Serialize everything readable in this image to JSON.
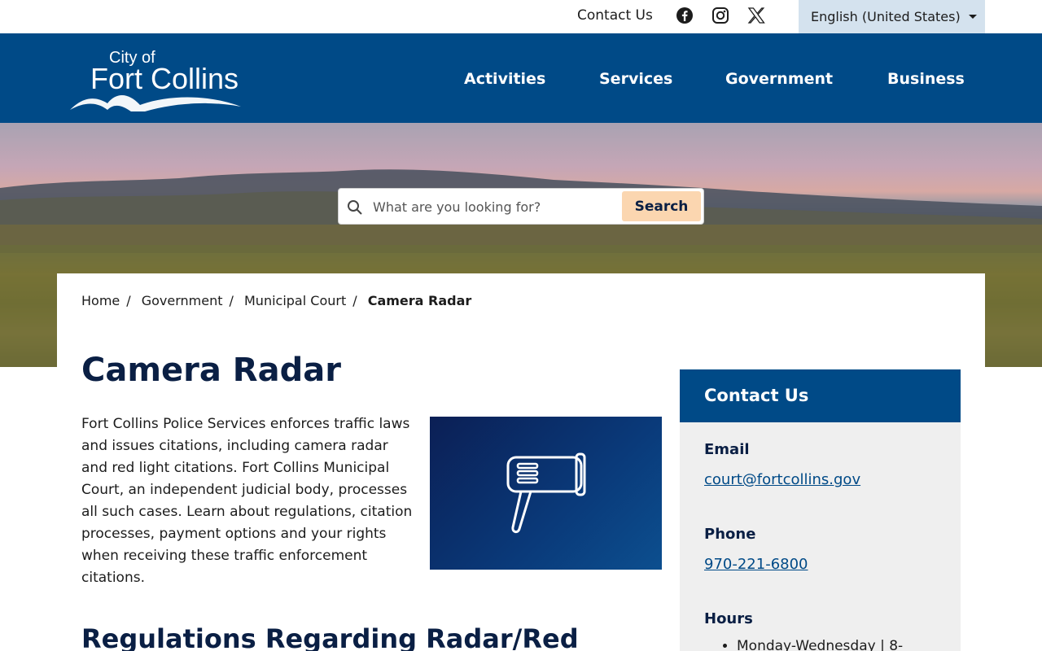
{
  "utility": {
    "contact_label": "Contact Us",
    "social": [
      "facebook-icon",
      "instagram-icon",
      "x-icon"
    ],
    "language": "English (United States)"
  },
  "header": {
    "logo_line1": "City of",
    "logo_line2": "Fort Collins",
    "nav": [
      "Activities",
      "Services",
      "Government",
      "Business"
    ]
  },
  "search": {
    "placeholder": "What are you looking for?",
    "button": "Search"
  },
  "breadcrumb": [
    "Home",
    "Government",
    "Municipal Court",
    "Camera Radar"
  ],
  "page": {
    "title": "Camera Radar",
    "intro": "Fort Collins Police Services enforces traffic laws and issues citations, including camera radar and red light citations. Fort Collins Municipal Court, an independent judicial body, processes all such cases. Learn about regulations, citation processes, payment options and your rights when receiving these traffic enforcement citations.",
    "subheading": "Regulations Regarding Radar/Red",
    "feature_icon": "radar-gun-icon"
  },
  "sidebar": {
    "heading": "Contact Us",
    "email_label": "Email",
    "email": "court@fortcollins.gov",
    "phone_label": "Phone",
    "phone": "970-221-6800",
    "hours_label": "Hours",
    "hours_first": "Monday-Wednesday | 8-"
  },
  "colors": {
    "brand_blue": "#004a87",
    "heading_navy": "#0a1f44",
    "search_button": "#fbd6b0",
    "language_bg": "#d4e2ee"
  }
}
